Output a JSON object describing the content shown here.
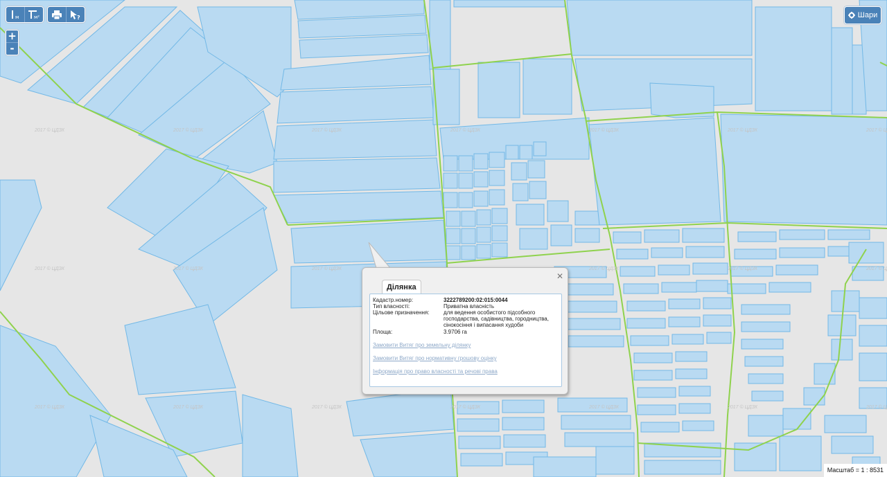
{
  "toolbar": {
    "buttons": [
      {
        "icon": "measure-distance-icon",
        "suffix": "м"
      },
      {
        "icon": "measure-area-icon",
        "suffix": "м²"
      },
      {
        "icon": "print-icon"
      },
      {
        "icon": "info-cursor-icon"
      }
    ]
  },
  "zoom": {
    "in_label": "+",
    "out_label": "-"
  },
  "layers": {
    "label": "Шари",
    "icon": "gear-icon"
  },
  "map": {
    "watermark": "2017 © ЦДЗК",
    "colors": {
      "background": "#e6e6e6",
      "parcel_fill": "#b9daf2",
      "parcel_stroke": "#72b8e6",
      "boundary": "#8fd24d"
    }
  },
  "popup": {
    "tab_label": "Ділянка",
    "fields": [
      {
        "label": "Кадастр.номер:",
        "value": "3222789200:02:015:0044"
      },
      {
        "label": "Тип власності:",
        "value": "Приватна власність"
      },
      {
        "label": "Цільове призначення:",
        "value": "для ведення особистого підсобного господарства, садівництва, городництва, сінокосіння і випасання худоби"
      },
      {
        "label": "Площа:",
        "value": "3.9706 га"
      }
    ],
    "links": [
      "Замовити Витяг про земельну ділянку",
      "Замовити Витяг про нормативну грошову оцінку",
      "Інформація про право власності та речові права"
    ]
  },
  "scale": {
    "text": "Масштаб = 1 : 8531"
  }
}
